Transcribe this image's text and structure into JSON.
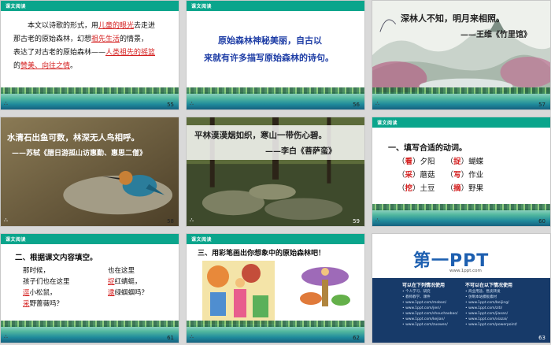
{
  "slides": [
    {
      "number": "55",
      "tag": "课文阅读",
      "lines": [
        [
          "本文以诗歌的形式，用",
          {
            "r": "儿童的眼光"
          },
          "去走进"
        ],
        [
          "那古老的原始森林，幻想",
          {
            "r": "祖先生活"
          },
          "的情景，"
        ],
        [
          "表达了对古老的原始森林——",
          {
            "r": "人类祖先的摇篮"
          }
        ],
        [
          "的",
          {
            "r": "赞美、向往之情"
          },
          "。"
        ]
      ]
    },
    {
      "number": "56",
      "tag": "课文阅读",
      "text1": "原始森林神秘美丽，自古以",
      "text2": "来就有许多描写原始森林的诗句。"
    },
    {
      "number": "57",
      "line1": "深林人不知，明月来相照。",
      "line2": "——王维《竹里馆》"
    },
    {
      "number": "58",
      "line1": "水清石出鱼可数，林深无人鸟相呼。",
      "line2": "——苏轼《腊日游孤山访惠勤、惠思二僧》"
    },
    {
      "number": "59",
      "line1": "平林漠漠烟如织，寒山一带伤心碧。",
      "line2": "——李白《菩萨蛮》"
    },
    {
      "number": "60",
      "tag": "课文阅读",
      "title": "一、填写合适的动词。",
      "rows": [
        [
          "（",
          "看",
          "）夕阳",
          "（",
          "捉",
          "）蝴蝶"
        ],
        [
          "（",
          "采",
          "）蘑菇",
          "（",
          "写",
          "）作业"
        ],
        [
          "（",
          "挖",
          "）土豆",
          "（",
          "摘",
          "）野果"
        ]
      ]
    },
    {
      "number": "61",
      "tag": "课文阅读",
      "title": "二、根据课文内容填空。",
      "left": [
        "那时候，",
        "孩子们也在这里",
        "逗小松鼠，",
        "采野蔷薇吗？"
      ],
      "left_red": [
        "",
        "",
        "逗",
        "采"
      ],
      "right": [
        "也在这里",
        "捉红蜻蜓，",
        "逮绿蝈蝈吗？"
      ],
      "right_red": [
        "",
        "捉",
        "逮"
      ]
    },
    {
      "number": "62",
      "tag": "课文阅读",
      "title": "三、用彩笔画出你想象中的原始森林吧！"
    },
    {
      "number": "63",
      "brand": "第一PPT",
      "url": "www.1ppt.com",
      "col1_title": "可以在下列情况使用",
      "col2_title": "不可以在以下情况使用",
      "col1": [
        "个人学习、研究",
        "教师教学、课件",
        "www.1ppt.com/moban/",
        "www.1ppt.com/jieri/",
        "www.1ppt.com/shouchaobao/",
        "www.1ppt.com/kejian/",
        "www.1ppt.com/zuowen/"
      ],
      "col2": [
        "商业用途、售卖转发",
        "仿制本站模板素材",
        "www.1ppt.com/beijing/",
        "www.1ppt.com/ziti/",
        "www.1ppt.com/jiaoan/",
        "www.1ppt.com/xiazai/",
        "www.1ppt.com/powerpoint/"
      ]
    }
  ],
  "colors": {
    "accent": "#0aa58c",
    "red": "#d42020",
    "blue": "#1f3ea6"
  }
}
